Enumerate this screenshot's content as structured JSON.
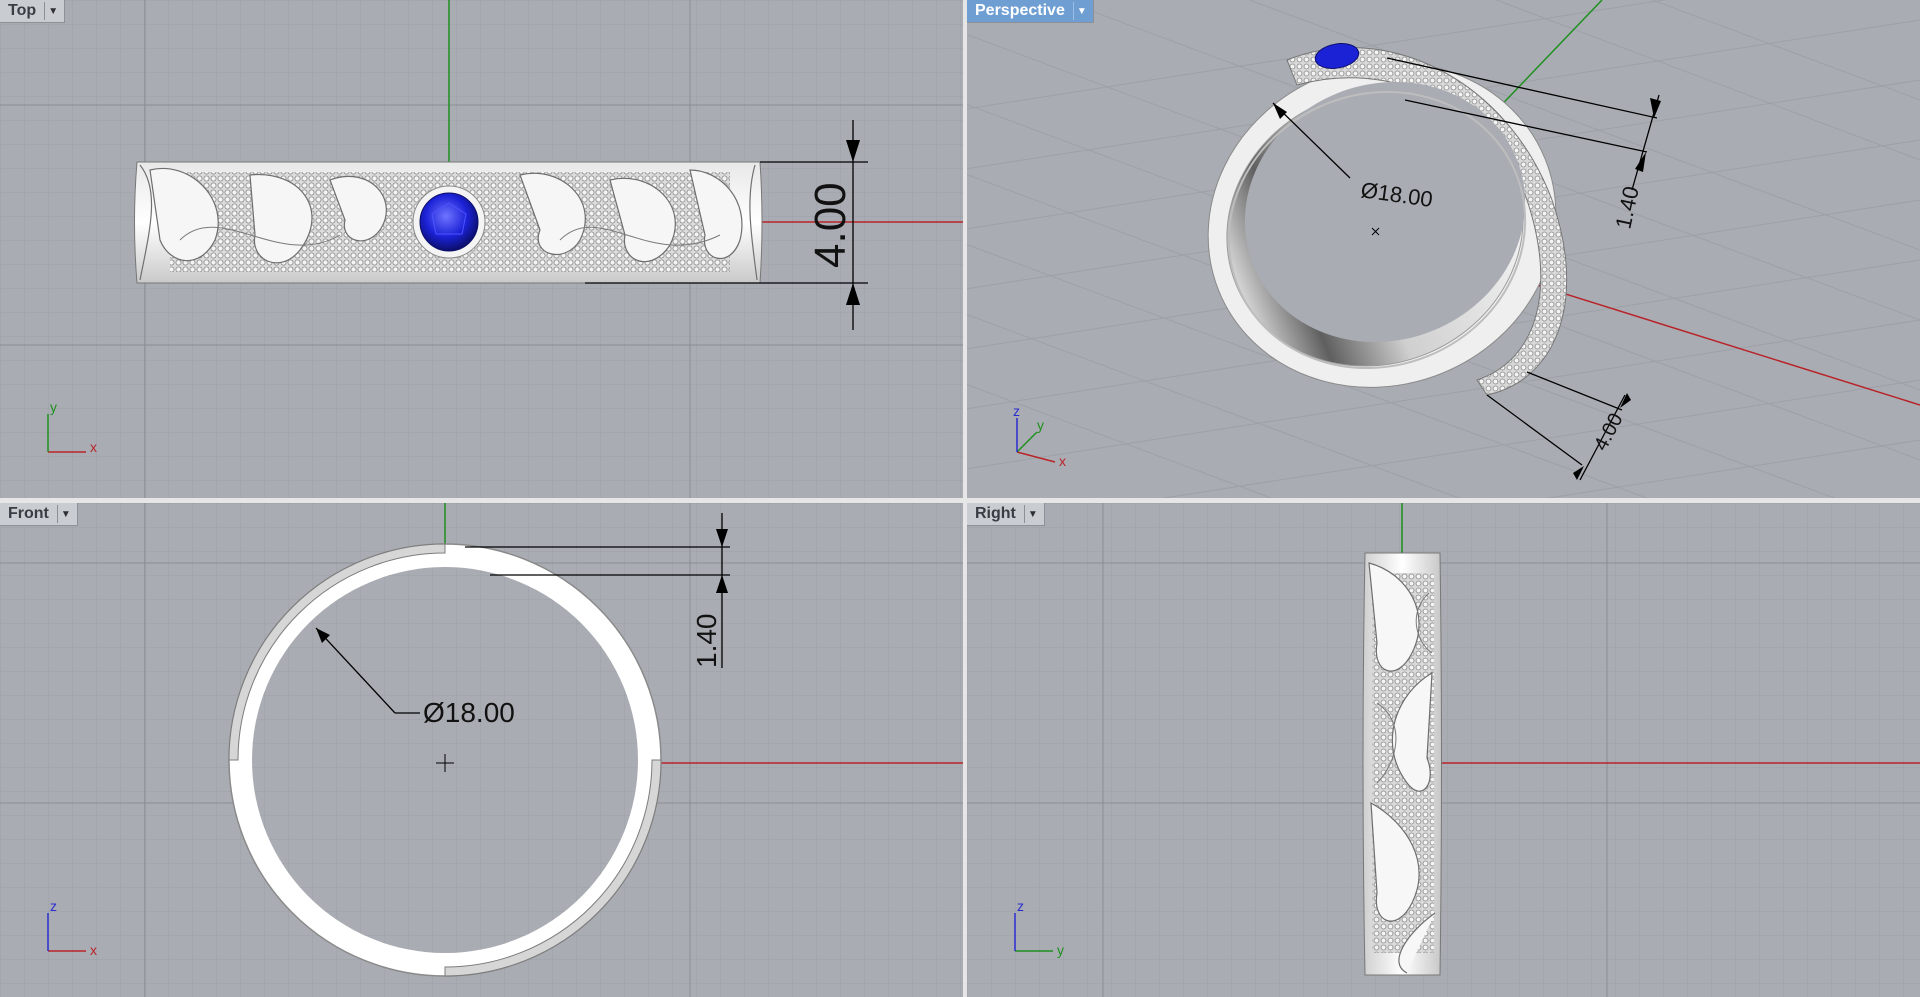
{
  "viewports": {
    "top": {
      "label": "Top",
      "dim_width": "4.00",
      "axis_h": "x",
      "axis_v": "y"
    },
    "perspective": {
      "label": "Perspective",
      "dim_diameter": "Ø18.00",
      "dim_thickness": "1.40",
      "dim_width": "4.00",
      "axis_x": "x",
      "axis_y": "y",
      "axis_z": "z"
    },
    "front": {
      "label": "Front",
      "dim_diameter": "Ø18.00",
      "dim_thickness": "1.40",
      "axis_h": "x",
      "axis_v": "z"
    },
    "right": {
      "label": "Right",
      "axis_h": "y",
      "axis_v": "z"
    }
  },
  "colors": {
    "viewport_bg": "#a9adb3",
    "grid_line": "#9da1a7",
    "grid_major": "#8b8f95",
    "x_axis": "#b8242a",
    "y_axis": "#1f8f1f",
    "gem": "#1b22d6",
    "active_tab": "#6f9ed3",
    "metal": "#f2f2f2"
  },
  "icons": [
    "dropdown-arrow-icon",
    "gem-icon",
    "axis-triad-icon"
  ]
}
